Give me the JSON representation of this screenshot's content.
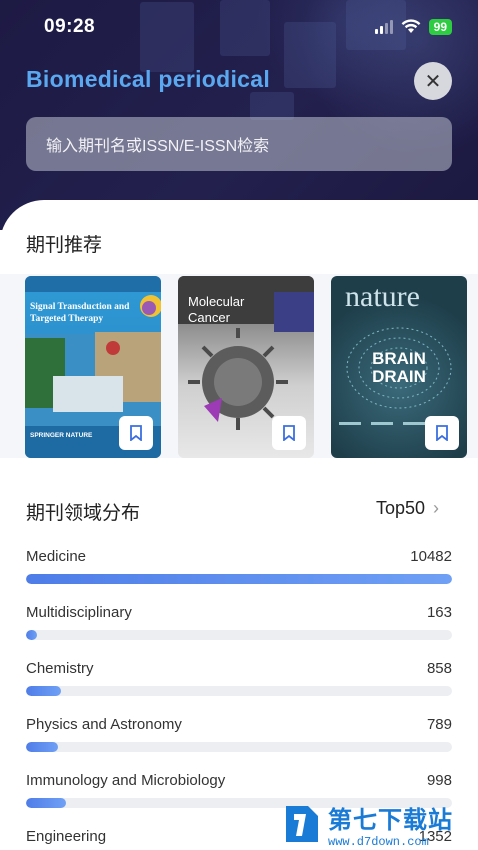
{
  "status": {
    "time": "09:28",
    "battery": "99"
  },
  "header": {
    "title": "Biomedical periodical",
    "close_glyph": "✕",
    "search_placeholder": "输入期刊名或ISSN/E-ISSN检索"
  },
  "recommend": {
    "title": "期刊推荐",
    "journals": [
      {
        "name": "Signal Transduction and Targeted Therapy",
        "publisher": "SPRINGER NATURE",
        "cover_color": "#2b8fc9"
      },
      {
        "name": "Molecular Cancer",
        "cover_color": "#6b6b6b"
      },
      {
        "name": "nature",
        "cover_headline": "BRAIN DRAIN",
        "cover_color": "#1e3e4a"
      }
    ]
  },
  "distribution": {
    "title": "期刊领域分布",
    "top_label": "Top50",
    "items": [
      {
        "label": "Medicine",
        "count": "10482",
        "fraction": 1.0
      },
      {
        "label": "Multidisciplinary",
        "count": "163",
        "fraction": 0.016
      },
      {
        "label": "Chemistry",
        "count": "858",
        "fraction": 0.082
      },
      {
        "label": "Physics and Astronomy",
        "count": "789",
        "fraction": 0.075
      },
      {
        "label": "Immunology and Microbiology",
        "count": "998",
        "fraction": 0.095
      },
      {
        "label": "Engineering",
        "count": "1352",
        "fraction": 0.129
      }
    ]
  },
  "watermark": {
    "cn": "第七下载站",
    "url": "www.d7down.com"
  },
  "colors": {
    "header_bg": "#1f1c48",
    "accent": "#5aa8f0",
    "bar_fill": "#4f7de8",
    "bar_track": "#eceef2"
  }
}
